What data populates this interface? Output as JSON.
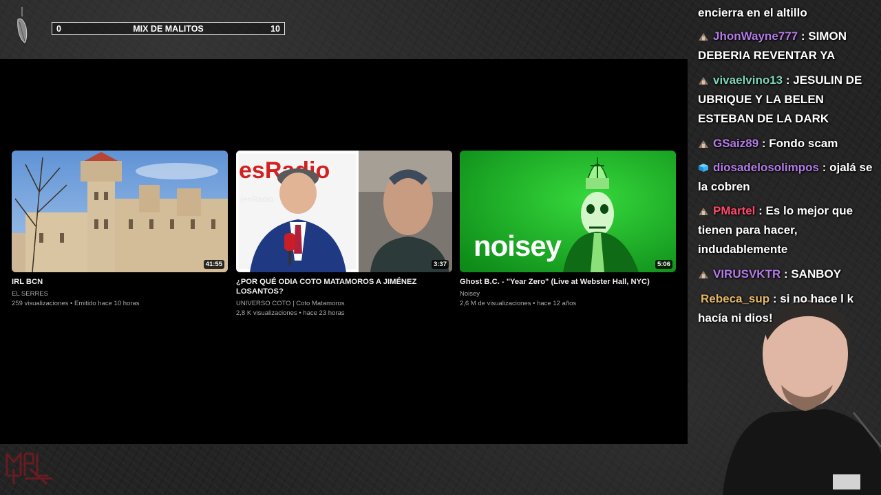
{
  "overlay": {
    "progress": {
      "start": "0",
      "title": "MIX DE MALITOS",
      "end": "10",
      "fraction": 0.0
    }
  },
  "videos": [
    {
      "title": "IRL BCN",
      "channel": "EL SERRES",
      "stats": "259 visualizaciones • Emitido hace 10 horas",
      "duration": "41:55"
    },
    {
      "title": "¿POR QUÉ ODIA COTO MATAMOROS A JIMÉNEZ LOSANTOS?",
      "channel": "UNIVERSO COTO | Coto Matamoros",
      "stats": "2,8 K visualizaciones • hace 23 horas",
      "duration": "3:37",
      "thumb_text_left": "esRadio",
      "thumb_text_small": "(esRadio · esRadio"
    },
    {
      "title": "Ghost B.C. - \"Year Zero\" (Live at Webster Hall, NYC)",
      "channel": "Noisey",
      "stats": "2,6 M de visualizaciones • hace 12 años",
      "duration": "5:06",
      "thumb_text": "noisey"
    }
  ],
  "chat": {
    "messages": [
      {
        "user": "",
        "text": "encierra en el altillo",
        "badge": "none"
      },
      {
        "user": "JhonWayne777",
        "text": "SIMON DEBERIA REVENTAR YA",
        "badge": "warrior-icon",
        "color": "#b57ce8"
      },
      {
        "user": "vivaelvino13",
        "text": "JESULIN DE UBRIQUE Y LA BELEN ESTEBAN DE LA DARK",
        "badge": "warrior-icon",
        "color": "#7fd5b8"
      },
      {
        "user": "GSaiz89",
        "text": "Fondo scam",
        "badge": "warrior-icon",
        "color": "#b57ce8"
      },
      {
        "user": "diosadelosolimpos",
        "text": "ojalá se la cobren",
        "badge": "cube-icon",
        "color": "#b57ce8"
      },
      {
        "user": "PMartel",
        "text": "Es lo mejor que tienen para hacer, indudablemente",
        "badge": "warrior-icon",
        "color": "#ff4a6e"
      },
      {
        "user": "VIRUSVKTR",
        "text": "SANBOY",
        "badge": "warrior-icon",
        "color": "#b57ce8"
      },
      {
        "user": "Rebeca_sup",
        "text": "si no hace l k hacía ni dios!",
        "badge": "none",
        "color": "#e6b86b"
      }
    ]
  },
  "colors": {
    "screen": "#000000",
    "background": "#232323"
  }
}
